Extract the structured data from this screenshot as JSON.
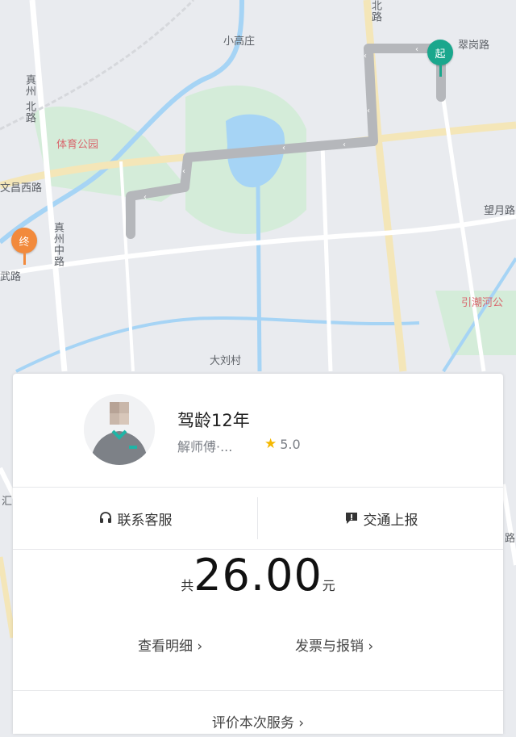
{
  "map": {
    "labels": {
      "zhenzhou_north_1": "真州",
      "zhenzhou_north_2": "北路",
      "xiaogaozhuang": "小高庄",
      "road_top": "路",
      "road_top2": "北",
      "cuigang": "翠岗路",
      "tiyu_park": "体育公园",
      "wenchang": "文昌西路",
      "wangyue": "望月路",
      "zhenzhou_mid": "真州中路",
      "wu_road": "武路",
      "yinchao": "引潮河公",
      "daliu": "大刘村",
      "road_left": "汇",
      "road_right": "路"
    },
    "start_pin": "起",
    "end_pin": "终",
    "colors": {
      "start": "#1aa78d",
      "end": "#f28a3c",
      "route": "#b5b7bb"
    }
  },
  "driver": {
    "driving_years": "驾龄12年",
    "name": "解师傅·...",
    "rating": "5.0"
  },
  "actions": {
    "contact": "联系客服",
    "report": "交通上报"
  },
  "fare": {
    "prefix": "共",
    "amount": "26.00",
    "unit": "元",
    "details": "查看明细 ›",
    "invoice": "发票与报销 ›"
  },
  "feedback": "评价本次服务 ›"
}
